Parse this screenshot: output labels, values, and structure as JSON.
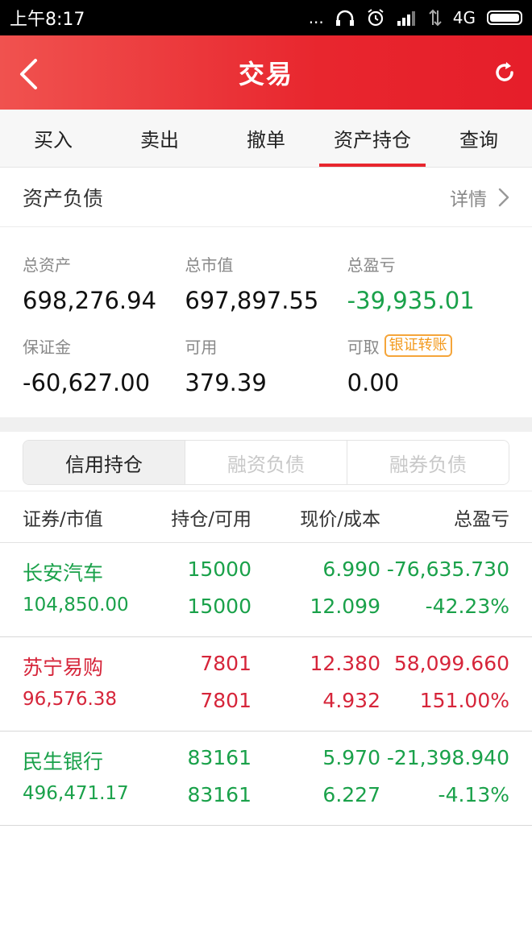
{
  "status_bar": {
    "time": "上午8:17",
    "dots": "...",
    "network": "4G"
  },
  "header": {
    "title": "交易",
    "icons": {
      "back": "chevron-left-icon",
      "refresh": "refresh-icon"
    }
  },
  "tabs": [
    {
      "label": "买入"
    },
    {
      "label": "卖出"
    },
    {
      "label": "撤单"
    },
    {
      "label": "资产持仓",
      "active": true
    },
    {
      "label": "查询"
    }
  ],
  "balance": {
    "section_label": "资产负债",
    "detail_label": "详情",
    "total_assets_label": "总资产",
    "total_assets": "698,276.94",
    "market_value_label": "总市值",
    "market_value": "697,897.55",
    "total_pnl_label": "总盈亏",
    "total_pnl": "-39,935.01",
    "margin_label": "保证金",
    "margin": "-60,627.00",
    "available_label": "可用",
    "available": "379.39",
    "withdrawable_label": "可取",
    "withdrawable": "0.00",
    "transfer_badge": "银证转账"
  },
  "segments": [
    {
      "label": "信用持仓",
      "active": true
    },
    {
      "label": "融资负债"
    },
    {
      "label": "融券负债"
    }
  ],
  "table": {
    "headers": [
      "证券/市值",
      "持仓/可用",
      "现价/成本",
      "总盈亏"
    ],
    "rows": [
      {
        "name": "长安汽车",
        "market_value": "104,850.00",
        "position": "15000",
        "available": "15000",
        "price": "6.990",
        "cost": "12.099",
        "pnl": "-76,635.730",
        "pnl_pct": "-42.23%",
        "trend": "down"
      },
      {
        "name": "苏宁易购",
        "market_value": "96,576.38",
        "position": "7801",
        "available": "7801",
        "price": "12.380",
        "cost": "4.932",
        "pnl": "58,099.660",
        "pnl_pct": "151.00%",
        "trend": "up"
      },
      {
        "name": "民生银行",
        "market_value": "496,471.17",
        "position": "83161",
        "available": "83161",
        "price": "5.970",
        "cost": "6.227",
        "pnl": "-21,398.940",
        "pnl_pct": "-4.13%",
        "trend": "down"
      }
    ]
  },
  "colors": {
    "accent": "#e8262e",
    "gain": "#d6253a",
    "loss": "#1aa14a",
    "badge": "#f39a1e"
  }
}
